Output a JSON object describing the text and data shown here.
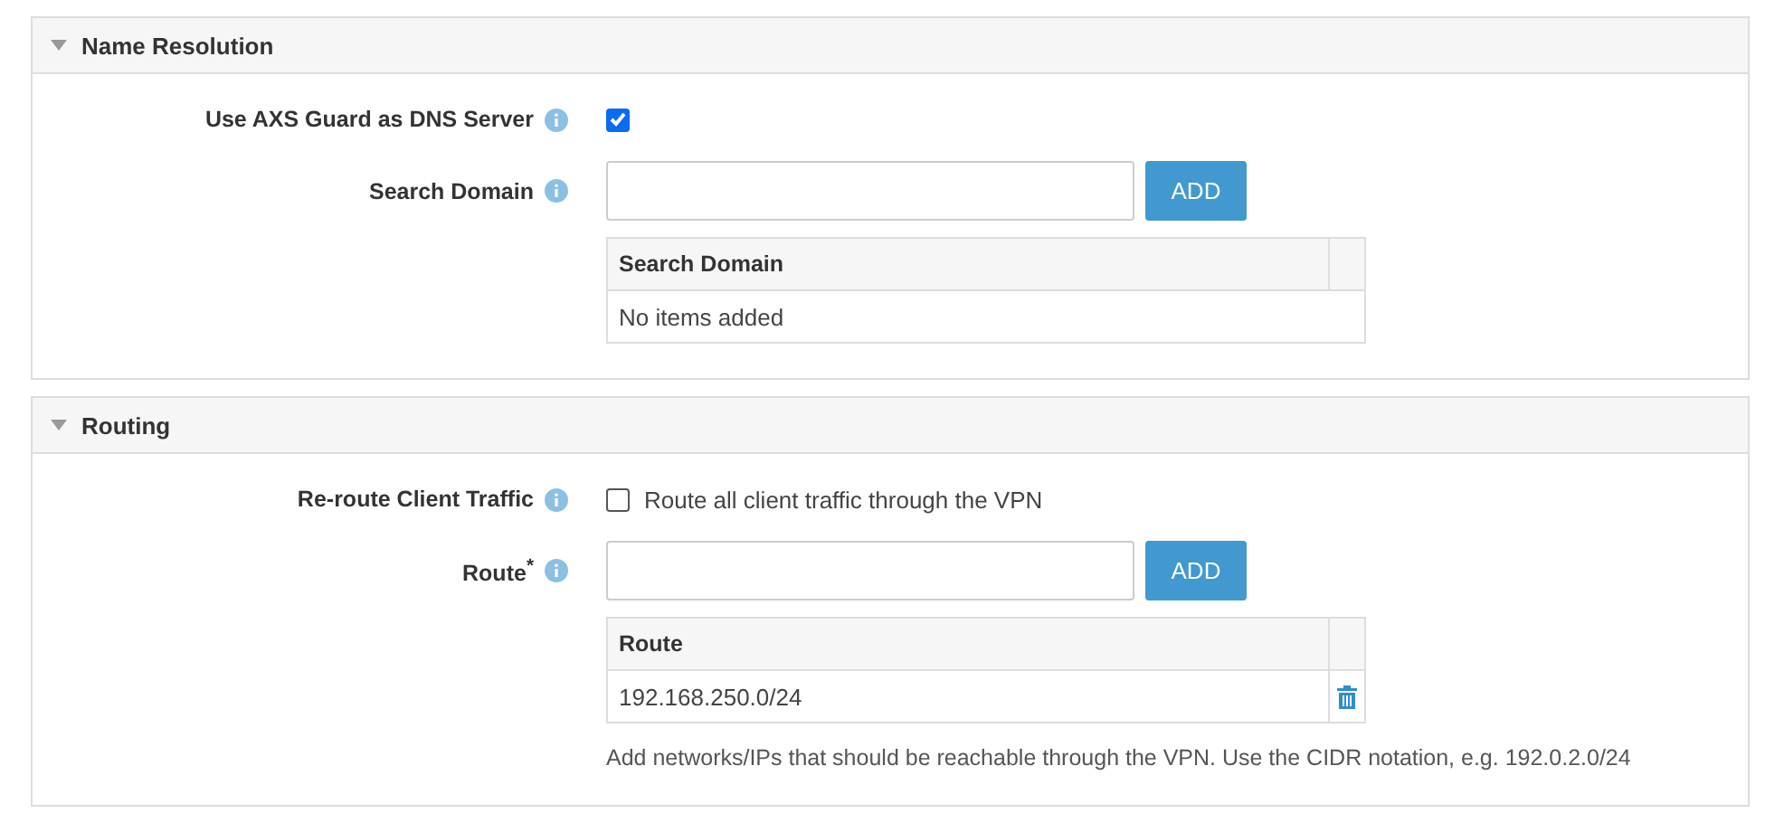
{
  "sections": [
    {
      "title": "Name Resolution",
      "expanded": true,
      "fields": [
        {
          "kind": "checkbox",
          "label": "Use AXS Guard as DNS Server",
          "checked": true
        },
        {
          "kind": "list",
          "label": "Search Domain",
          "button": "ADD",
          "column": "Search Domain",
          "empty": "No items added"
        }
      ]
    },
    {
      "title": "Routing",
      "expanded": true,
      "fields": [
        {
          "kind": "checkbox",
          "label": "Re-route Client Traffic",
          "checked": false,
          "text": "Route all client traffic through the VPN"
        },
        {
          "kind": "list",
          "label": "Route$^{*}$",
          "button": "ADD",
          "column": "Route",
          "rows": [
            "192.168.250.0/24"
          ],
          "help": "Add networks/IPs that should be reachable through the VPN. Use the CIDR notation, e.g. 192.0.2.0/24"
        }
      ]
    }
  ]
}
